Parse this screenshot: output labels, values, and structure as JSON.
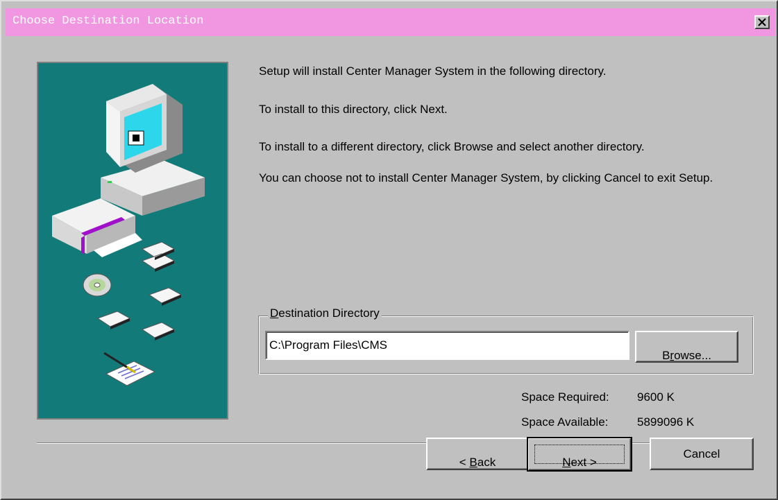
{
  "window": {
    "title": "Choose Destination Location",
    "close_label": "Close"
  },
  "messages": {
    "line1": "Setup will install Center Manager System in the following directory.",
    "line2": "To install to this directory, click Next.",
    "line3": "To install to a different directory, click Browse and select another directory.",
    "line4": "You can choose not to install Center Manager System, by clicking Cancel to exit Setup."
  },
  "destination": {
    "group_label_accel": "D",
    "group_label_rest": "estination Directory",
    "path": "C:\\Program Files\\CMS",
    "browse_pre": "B",
    "browse_accel": "r",
    "browse_post": "owse..."
  },
  "space": {
    "required_label": "Space Required:",
    "required_value": "9600 K",
    "available_label": "Space Available:",
    "available_value": "5899096 K"
  },
  "buttons": {
    "back_pre": "< ",
    "back_accel": "B",
    "back_post": "ack",
    "next_accel": "N",
    "next_post": "ext >",
    "cancel": "Cancel"
  },
  "colors": {
    "title_bar": "#f197e1",
    "illustration_bg": "#137a7a",
    "dialog_face": "#c0c0c0"
  }
}
